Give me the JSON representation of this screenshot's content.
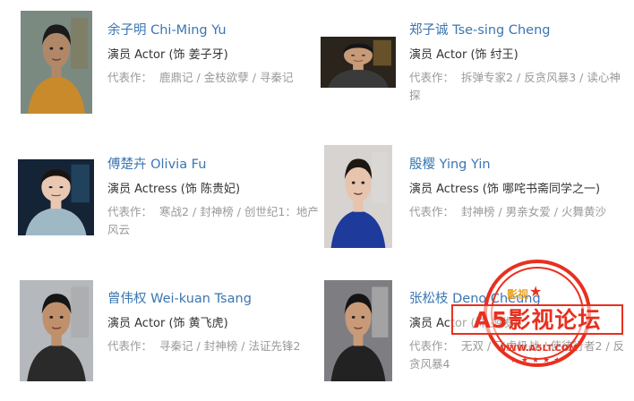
{
  "labels": {
    "works_label": "代表作："
  },
  "cast": [
    {
      "name": "余子明 Chi-Ming Yu",
      "role": "演员 Actor (饰 姜子牙)",
      "works": [
        "鹿鼎记",
        "金枝欲孽",
        "寻秦记"
      ],
      "photo": {
        "bg": "#7a8a80",
        "skin": "#b08868",
        "hair": "#1b1b1b",
        "cloth": "#c98a2c",
        "accent": "#8a6a3c"
      }
    },
    {
      "name": "郑子诚 Tse-sing Cheng",
      "role": "演员 Actor (饰 纣王)",
      "works": [
        "拆弹专家2",
        "反贪风暴3",
        "读心神探"
      ],
      "photo": {
        "bg": "#2a241c",
        "skin": "#c79a78",
        "hair": "#151515",
        "cloth": "#3a3a3a",
        "accent": "#d9a545"
      }
    },
    {
      "name": "傅楚卉 Olivia Fu",
      "role": "演员 Actress (饰 陈贵妃)",
      "works": [
        "寒战2",
        "封神榜",
        "创世纪1：地产风云"
      ],
      "photo": {
        "bg": "#142436",
        "skin": "#e8c8b2",
        "hair": "#1a1410",
        "cloth": "#9fb8c6",
        "accent": "#3a7aa6"
      }
    },
    {
      "name": "殷樱 Ying Yin",
      "role": "演员 Actress (饰 哪咤书斋同学之一)",
      "works": [
        "封神榜",
        "男亲女爱",
        "火舞黄沙"
      ],
      "photo": {
        "bg": "#d6d3d0",
        "skin": "#e6c4ad",
        "hair": "#1d1712",
        "cloth": "#1e3a9a",
        "accent": "#e3e0dc"
      }
    },
    {
      "name": "曾伟权 Wei-kuan Tsang",
      "role": "演员 Actor (饰 黄飞虎)",
      "works": [
        "寻秦记",
        "封神榜",
        "法证先锋2"
      ],
      "photo": {
        "bg": "#b5b8bc",
        "skin": "#c08f6c",
        "hair": "#151515",
        "cloth": "#2a2a2a",
        "accent": "#9b9b9b"
      }
    },
    {
      "name": "张松枝 Deno Cheung",
      "role": "演员 Actor (饰 姬发)",
      "works": [
        "无双",
        "飞虎极战",
        "使徒行者2",
        "反贪风暴4"
      ],
      "photo": {
        "bg": "#7e7e82",
        "skin": "#c99a78",
        "hair": "#141414",
        "cloth": "#222222",
        "accent": "#e9e7e4"
      }
    }
  ],
  "watermark": {
    "title": "A5影视论坛",
    "top_text": "影视",
    "url": "WWW.A5LT.COM",
    "color": "#e8301f"
  }
}
